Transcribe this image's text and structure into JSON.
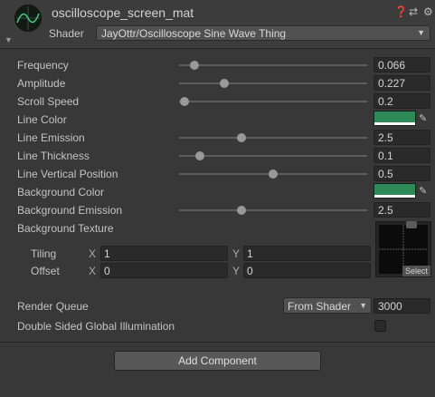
{
  "header": {
    "material_name": "oscilloscope_screen_mat",
    "shader_label": "Shader",
    "shader_value": "JayOttr/Oscilloscope Sine Wave Thing",
    "icons": [
      "help-icon",
      "presets-icon",
      "settings-icon"
    ]
  },
  "properties": {
    "frequency": {
      "label": "Frequency",
      "value": "0.066",
      "slider_fraction": 0.08
    },
    "amplitude": {
      "label": "Amplitude",
      "value": "0.227",
      "slider_fraction": 0.24
    },
    "scroll_speed": {
      "label": "Scroll Speed",
      "value": "0.2",
      "slider_fraction": 0.03
    },
    "line_color": {
      "label": "Line Color",
      "color": "#2e8b57"
    },
    "line_emission": {
      "label": "Line Emission",
      "value": "2.5",
      "slider_fraction": 0.33
    },
    "line_thickness": {
      "label": "Line Thickness",
      "value": "0.1",
      "slider_fraction": 0.11
    },
    "line_vertical_position": {
      "label": "Line Vertical Position",
      "value": "0.5",
      "slider_fraction": 0.5
    },
    "background_color": {
      "label": "Background Color",
      "color": "#2e8b57"
    },
    "background_emission": {
      "label": "Background Emission",
      "value": "2.5",
      "slider_fraction": 0.33
    },
    "background_texture": {
      "label": "Background Texture",
      "select_label": "Select"
    }
  },
  "texture": {
    "tiling": {
      "label": "Tiling",
      "x_axis": "X",
      "x": "1",
      "y_axis": "Y",
      "y": "1"
    },
    "offset": {
      "label": "Offset",
      "x_axis": "X",
      "x": "0",
      "y_axis": "Y",
      "y": "0"
    }
  },
  "render_queue": {
    "label": "Render Queue",
    "mode": "From Shader",
    "value": "3000"
  },
  "double_sided_gi": {
    "label": "Double Sided Global Illumination",
    "checked": false
  },
  "add_component_label": "Add Component"
}
